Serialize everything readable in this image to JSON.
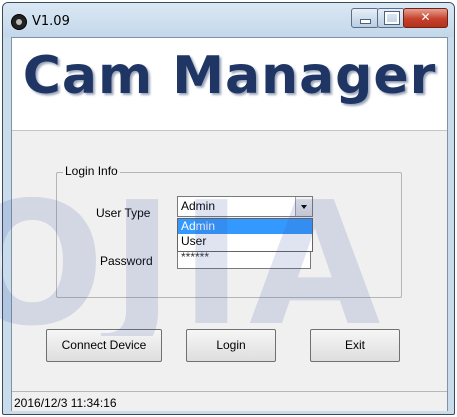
{
  "window": {
    "title": "V1.09",
    "banner_title": "Cam Manager"
  },
  "login_group": {
    "label": "Login Info",
    "user_type_label": "User Type",
    "password_label": "Password",
    "user_type_value": "Admin",
    "user_type_options": [
      "Admin",
      "User"
    ],
    "password_value": "******"
  },
  "buttons": {
    "connect": "Connect Device",
    "login": "Login",
    "exit": "Exit"
  },
  "status": {
    "datetime": "2016/12/3 11:34:16"
  },
  "watermark": "OJIA",
  "icons": {
    "app": "camera-icon",
    "minimize": "minimize-icon",
    "maximize": "maximize-icon",
    "close": "close-icon"
  },
  "colors": {
    "banner_text": "#1f3563",
    "selection": "#3399ff",
    "close_button": "#c5412c"
  }
}
